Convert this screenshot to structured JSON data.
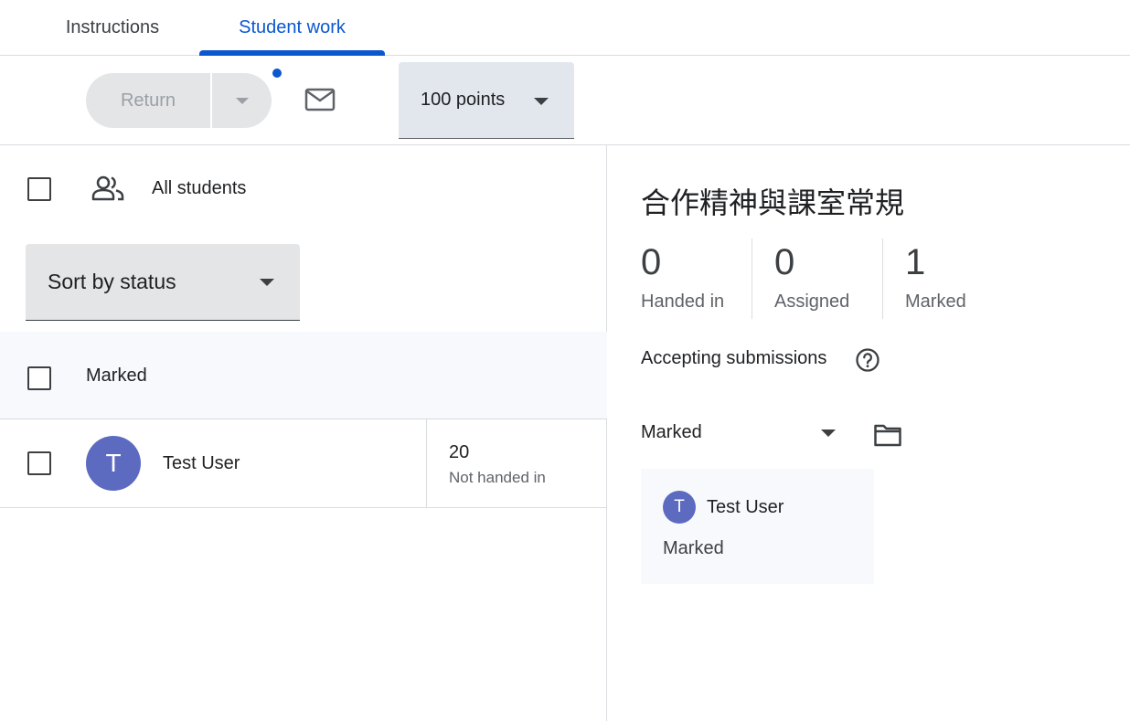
{
  "tabs": [
    {
      "label": "Instructions",
      "active": false
    },
    {
      "label": "Student work",
      "active": true
    }
  ],
  "toolbar": {
    "return_label": "Return",
    "points_label": "100 points"
  },
  "left": {
    "all_students_label": "All students",
    "sort_label": "Sort by status",
    "group_label": "Marked",
    "rows": [
      {
        "avatar_letter": "T",
        "name": "Test User",
        "grade": "20",
        "status": "Not handed in"
      }
    ]
  },
  "right": {
    "title": "合作精神與課室常規",
    "stats": [
      {
        "value": "0",
        "label": "Handed in"
      },
      {
        "value": "0",
        "label": "Assigned"
      },
      {
        "value": "1",
        "label": "Marked"
      }
    ],
    "accepting_label": "Accepting submissions",
    "filter_label": "Marked",
    "card": {
      "avatar_letter": "T",
      "name": "Test User",
      "status": "Marked"
    }
  },
  "colors": {
    "accent": "#0b57d0",
    "avatar": "#5c6bc0"
  },
  "icons": [
    "chevron-down-icon",
    "mail-icon",
    "people-icon",
    "help-icon",
    "folder-icon"
  ]
}
